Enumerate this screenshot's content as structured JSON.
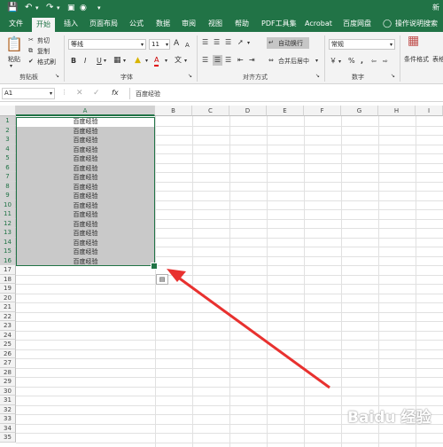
{
  "titlebar": {
    "right_text": "新"
  },
  "tabs": [
    {
      "label": "文件"
    },
    {
      "label": "开始"
    },
    {
      "label": "插入"
    },
    {
      "label": "页面布局"
    },
    {
      "label": "公式"
    },
    {
      "label": "数据"
    },
    {
      "label": "审阅"
    },
    {
      "label": "视图"
    },
    {
      "label": "帮助"
    },
    {
      "label": "PDF工具集"
    },
    {
      "label": "Acrobat"
    },
    {
      "label": "百度网盘"
    },
    {
      "label": "操作说明搜索"
    }
  ],
  "ribbon": {
    "clipboard": {
      "paste": "粘贴",
      "cut": "剪切",
      "copy": "复制",
      "format_painter": "格式刷",
      "group": "剪贴板"
    },
    "font": {
      "font_name": "等线",
      "font_size": "11",
      "bold": "B",
      "italic": "I",
      "underline": "U",
      "grow": "A",
      "shrink": "A",
      "group": "字体"
    },
    "alignment": {
      "wrap": "自动换行",
      "merge": "合并后居中",
      "group": "对齐方式"
    },
    "number": {
      "format": "常规",
      "percent": "%",
      "comma": ",",
      "group": "数字"
    },
    "styles": {
      "conditional": "条件格式",
      "table": "表格"
    }
  },
  "formula_bar": {
    "name_box": "A1",
    "fx": "fx",
    "value": "百度经验"
  },
  "grid": {
    "columns": [
      "A",
      "B",
      "C",
      "D",
      "E",
      "F",
      "G",
      "H",
      "I"
    ],
    "rows": [
      "1",
      "2",
      "3",
      "4",
      "5",
      "6",
      "7",
      "8",
      "9",
      "10",
      "11",
      "12",
      "13",
      "14",
      "15",
      "16",
      "17",
      "18",
      "19",
      "20",
      "21",
      "22",
      "23",
      "24",
      "25",
      "26",
      "27",
      "28",
      "29",
      "30",
      "31",
      "32",
      "33",
      "34",
      "35"
    ],
    "colA_values": [
      "百度经验",
      "百度经验",
      "百度经验",
      "百度经验",
      "百度经验",
      "百度经验",
      "百度经验",
      "百度经验",
      "百度经验",
      "百度经验",
      "百度经验",
      "百度经验",
      "百度经验",
      "百度经验",
      "百度经验",
      "百度经验"
    ]
  },
  "colors": {
    "accent": "#217346",
    "selection": "#c9c9c9",
    "arrow": "#e8312f"
  },
  "watermark": "Baidu 经验"
}
